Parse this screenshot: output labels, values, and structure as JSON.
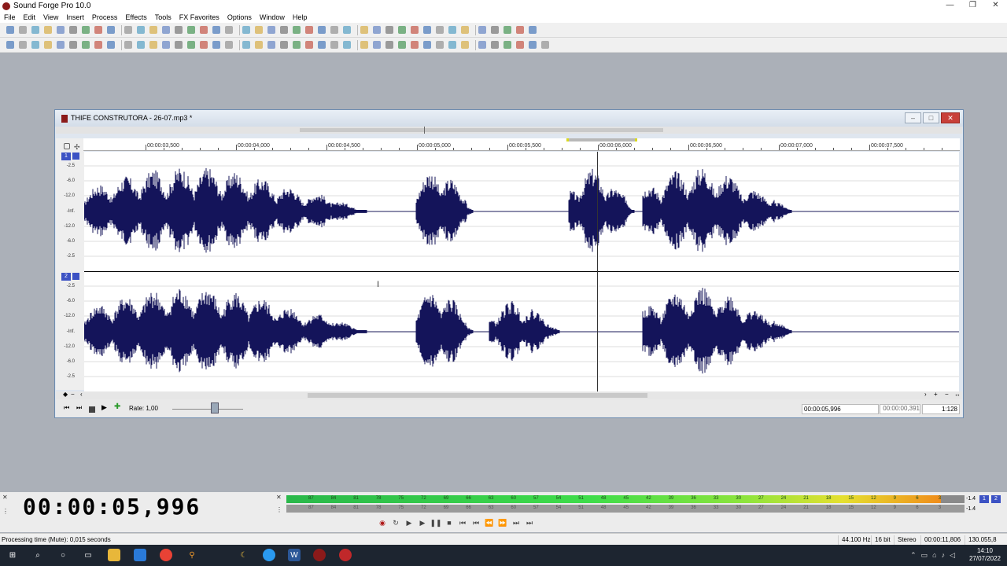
{
  "app": {
    "title": "Sound Forge Pro 10.0"
  },
  "menu": [
    "File",
    "Edit",
    "View",
    "Insert",
    "Process",
    "Effects",
    "Tools",
    "FX Favorites",
    "Options",
    "Window",
    "Help"
  ],
  "doc": {
    "title": "THIFE CONSTRUTORA - 26-07.mp3 *",
    "ruler_labels": [
      "00:00:03,500",
      "00:00:04,000",
      "00:00:04,500",
      "00:00:05,000",
      "00:00:05,500",
      "00:00:06,000",
      "00:00:06,500",
      "00:00:07,000",
      "00:00:07,500"
    ],
    "channels": [
      "1",
      "2"
    ],
    "scale_labels": [
      "-2.5",
      "-6.0",
      "-12.0",
      "-Inf.",
      "-12.0",
      "-6.0",
      "-2.5"
    ],
    "rate_label": "Rate: 1,00",
    "cursor_pos": "00:00:05,996",
    "selection_len": "00:00:00,391",
    "zoom": "1:128"
  },
  "time_display": "00:00:05,996",
  "meters": {
    "labels": [
      "87",
      "84",
      "81",
      "78",
      "75",
      "72",
      "69",
      "66",
      "63",
      "60",
      "57",
      "54",
      "51",
      "48",
      "45",
      "42",
      "39",
      "36",
      "33",
      "30",
      "27",
      "24",
      "21",
      "18",
      "15",
      "12",
      "9",
      "6",
      "3"
    ],
    "peak_top": "-1.4",
    "peak_bottom": "-1.4",
    "ch1": "1",
    "ch2": "2"
  },
  "status": {
    "text": "Processing time (Mute): 0,015 seconds",
    "rate": "44.100 Hz",
    "bits": "16 bit",
    "mode": "Stereo",
    "length": "00:00:11,806",
    "free": "130.055,8 MB"
  },
  "clock": {
    "time": "14:10",
    "date": "27/07/2022"
  }
}
